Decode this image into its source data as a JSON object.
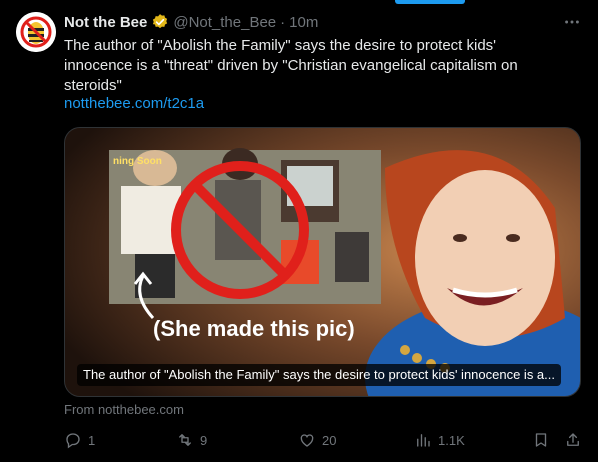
{
  "tweet": {
    "author_name": "Not the Bee",
    "handle": "@Not_the_Bee",
    "separator": "·",
    "time": "10m",
    "text": "The author of \"Abolish the Family\" says the desire to protect kids' innocence is a \"threat\" driven by \"Christian evangelical capitalism on steroids\"",
    "link": "notthebee.com/t2c1a"
  },
  "card": {
    "inset_label": "ning Soon",
    "overlay_text": "(She made this pic)",
    "caption": "The author of \"Abolish the Family\" says the desire to protect kids' innocence is a...",
    "source": "From notthebee.com"
  },
  "actions": {
    "replies": "1",
    "reposts": "9",
    "likes": "20",
    "views": "1.1K"
  },
  "colors": {
    "accent": "#1d9bf0",
    "muted": "#71767b",
    "verified_gold": "#e2b719",
    "no_symbol": "#e0201b"
  },
  "icons": {
    "verified": "verified-badge-icon",
    "more": "more-icon",
    "reply": "reply-icon",
    "repost": "repost-icon",
    "like": "like-icon",
    "views": "views-icon",
    "bookmark": "bookmark-icon",
    "share": "share-icon"
  }
}
